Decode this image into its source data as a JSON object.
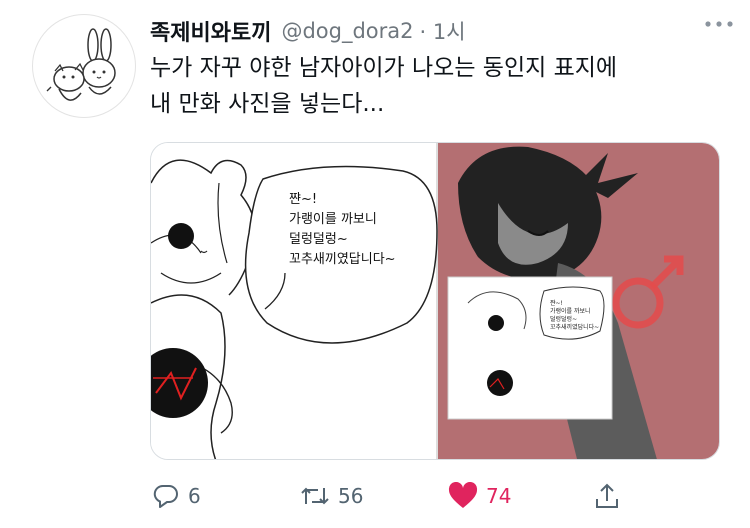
{
  "tweet": {
    "display_name": "족제비와토끼",
    "handle": "@dog_dora2",
    "time": "· 1시",
    "text_line1": "누가 자꾸 야한 남자아이가 나오는 동인지 표지에",
    "text_line2": "내 만화 사진을 넣는다..."
  },
  "media": {
    "bubble_lines": [
      "쨘~!",
      "가랭이를 까보니",
      "덜렁덜렁~",
      "꼬추새끼였답니다~"
    ],
    "small_bubble_lines": [
      "쨘~!",
      "가랭이를 까보니",
      "덜렁덜렁~",
      "꼬추새끼였답니다~"
    ]
  },
  "actions": {
    "replies": "6",
    "retweets": "56",
    "likes": "74"
  },
  "colors": {
    "like": "#e0245e",
    "cover_bg": "#b46f72",
    "muted": "#536471"
  },
  "icons": {
    "more": "more-dots-icon",
    "reply": "reply-icon",
    "retweet": "retweet-icon",
    "like": "heart-icon",
    "share": "share-icon"
  }
}
